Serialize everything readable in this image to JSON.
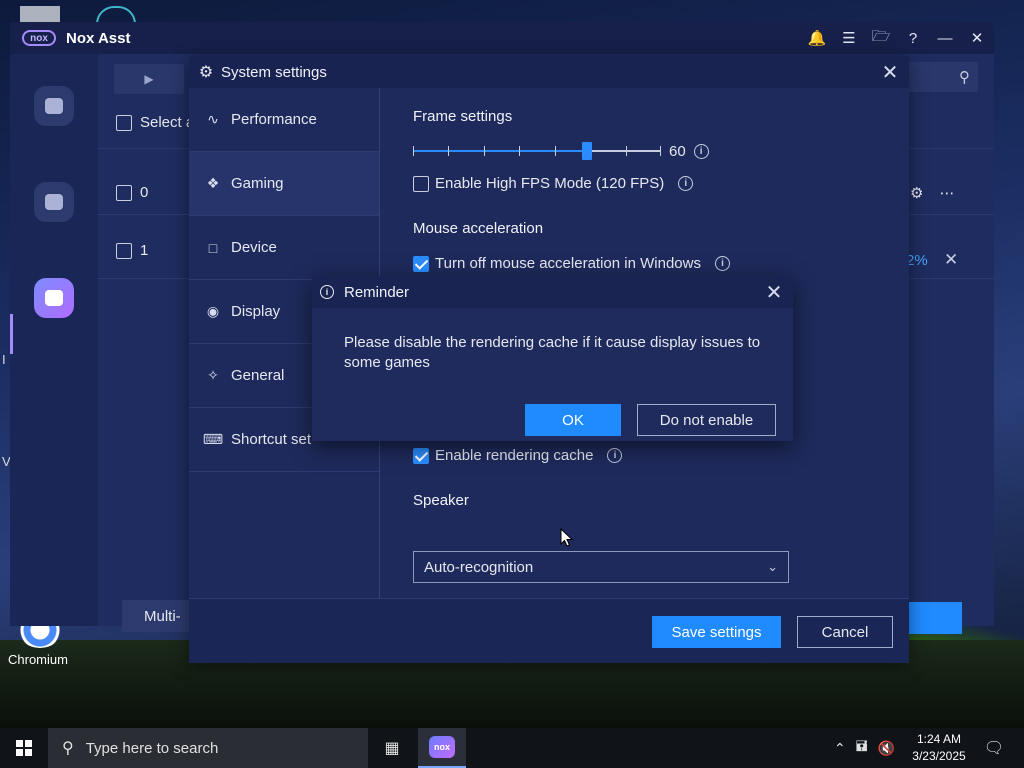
{
  "desktop": {
    "chromium_label": "Chromium",
    "edge_chars": [
      "I",
      "V"
    ]
  },
  "nox": {
    "title": "Nox Asst",
    "select_all_label": "Select a",
    "rows": [
      "0",
      "1"
    ],
    "percent_text": "2%",
    "multi_label": "Multi-",
    "titlebar_icons": [
      "bell-icon",
      "menu-icon",
      "folder-icon",
      "help-icon",
      "minimize-icon",
      "close-icon"
    ]
  },
  "settings": {
    "title": "System settings",
    "nav": [
      {
        "label": "Performance",
        "icon": "pulse-icon"
      },
      {
        "label": "Gaming",
        "icon": "gamepad-icon"
      },
      {
        "label": "Device",
        "icon": "device-icon"
      },
      {
        "label": "Display",
        "icon": "palette-icon"
      },
      {
        "label": "General",
        "icon": "puzzle-icon"
      },
      {
        "label": "Shortcut set",
        "icon": "keyboard-icon"
      }
    ],
    "active_nav": "Gaming",
    "frame_settings_title": "Frame settings",
    "frame_value": "60",
    "frame_slider_fraction": 0.7,
    "high_fps_label": "Enable High FPS Mode (120 FPS)",
    "high_fps_checked": false,
    "mouse_title": "Mouse acceleration",
    "mouse_accel_label": "Turn off mouse acceleration in Windows",
    "mouse_accel_checked": true,
    "rendering_cache_label": "Enable rendering cache",
    "rendering_cache_checked": true,
    "speaker_title": "Speaker",
    "speaker_value": "Auto-recognition",
    "save_label": "Save settings",
    "cancel_label": "Cancel"
  },
  "reminder": {
    "title": "Reminder",
    "message": "Please disable the rendering cache if it cause display issues to some games",
    "ok_label": "OK",
    "no_label": "Do not enable"
  },
  "taskbar": {
    "search_placeholder": "Type here to search",
    "time": "1:24 AM",
    "date": "3/23/2025",
    "nox_logo_text": "nox"
  },
  "colors": {
    "accent": "#1f8bff",
    "window_bg": "#1e2a5b"
  }
}
